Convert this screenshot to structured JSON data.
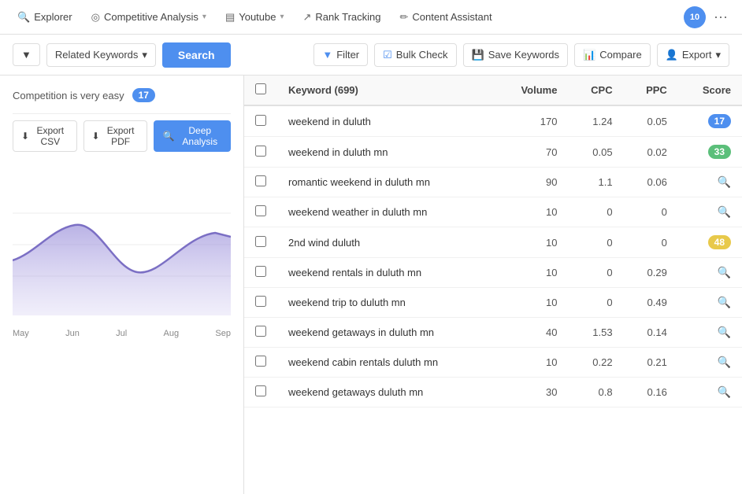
{
  "topnav": {
    "items": [
      {
        "id": "explorer",
        "label": "Explorer",
        "icon": "🔍",
        "hasChevron": false
      },
      {
        "id": "competitive-analysis",
        "label": "Competitive Analysis",
        "icon": "◎",
        "hasChevron": true
      },
      {
        "id": "youtube",
        "label": "Youtube",
        "icon": "▤",
        "hasChevron": true
      },
      {
        "id": "rank-tracking",
        "label": "Rank Tracking",
        "icon": "↗",
        "hasChevron": false
      },
      {
        "id": "content-assistant",
        "label": "Content Assistant",
        "icon": "✏",
        "hasChevron": false
      }
    ],
    "avatar_text": "10",
    "dots": "···"
  },
  "toolbar": {
    "dropdown1_label": "▼",
    "related_keywords_label": "Related Keywords",
    "search_label": "Search",
    "filter_label": "Filter",
    "bulk_check_label": "Bulk Check",
    "save_keywords_label": "Save Keywords",
    "compare_label": "Compare",
    "export_label": "Export"
  },
  "left_panel": {
    "competition_label": "Competition is very easy",
    "competition_badge": "17",
    "export_csv_label": "Export CSV",
    "export_pdf_label": "Export PDF",
    "deep_analysis_label": "Deep Analysis",
    "chart_months": [
      "May",
      "Jun",
      "Jul",
      "Aug",
      "Sep"
    ]
  },
  "table": {
    "header": {
      "keyword_col": "Keyword (699)",
      "volume_col": "Volume",
      "cpc_col": "CPC",
      "ppc_col": "PPC",
      "score_col": "Score"
    },
    "rows": [
      {
        "keyword": "weekend in duluth",
        "volume": 170,
        "cpc": 1.24,
        "ppc": 0.05,
        "score": 17,
        "score_color": "#4e8fef",
        "has_badge": true
      },
      {
        "keyword": "weekend in duluth mn",
        "volume": 70,
        "cpc": 0.05,
        "ppc": 0.02,
        "score": 33,
        "score_color": "#5bbf7a",
        "has_badge": true
      },
      {
        "keyword": "romantic weekend in duluth mn",
        "volume": 90,
        "cpc": 1.1,
        "ppc": 0.06,
        "score": null,
        "score_color": null,
        "has_badge": false
      },
      {
        "keyword": "weekend weather in duluth mn",
        "volume": 10,
        "cpc": 0,
        "ppc": 0,
        "score": null,
        "score_color": null,
        "has_badge": false
      },
      {
        "keyword": "2nd wind duluth",
        "volume": 10,
        "cpc": 0,
        "ppc": 0,
        "score": 48,
        "score_color": "#e8c94a",
        "has_badge": true
      },
      {
        "keyword": "weekend rentals in duluth mn",
        "volume": 10,
        "cpc": 0,
        "ppc": 0.29,
        "score": null,
        "score_color": null,
        "has_badge": false
      },
      {
        "keyword": "weekend trip to duluth mn",
        "volume": 10,
        "cpc": 0,
        "ppc": 0.49,
        "score": null,
        "score_color": null,
        "has_badge": false
      },
      {
        "keyword": "weekend getaways in duluth mn",
        "volume": 40,
        "cpc": 1.53,
        "ppc": 0.14,
        "score": null,
        "score_color": null,
        "has_badge": false
      },
      {
        "keyword": "weekend cabin rentals duluth mn",
        "volume": 10,
        "cpc": 0.22,
        "ppc": 0.21,
        "score": null,
        "score_color": null,
        "has_badge": false
      },
      {
        "keyword": "weekend getaways duluth mn",
        "volume": 30,
        "cpc": 0.8,
        "ppc": 0.16,
        "score": null,
        "score_color": null,
        "has_badge": false
      }
    ]
  }
}
